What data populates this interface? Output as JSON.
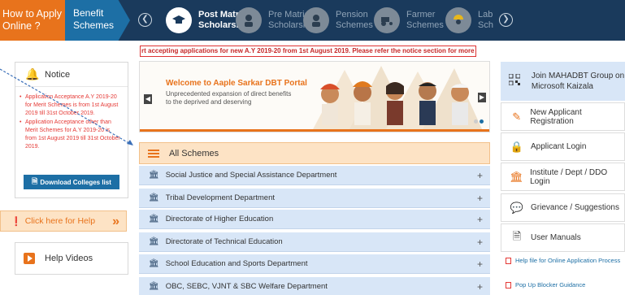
{
  "topbar": {
    "howto_label": "How to Apply Online ?",
    "benefit_label": "Benefit Schemes",
    "schemes": [
      {
        "label": "Post Matric Scholarship",
        "active": true,
        "icon": "graduation-cap-icon"
      },
      {
        "label": "Pre Matric Scholarship",
        "active": false,
        "icon": "student-icon"
      },
      {
        "label": "Pension Schemes",
        "active": false,
        "icon": "elderly-person-icon"
      },
      {
        "label": "Farmer Schemes",
        "active": false,
        "icon": "tractor-icon"
      },
      {
        "label": "Lab Sch",
        "active": false,
        "icon": "worker-icon"
      }
    ]
  },
  "ticker": {
    "text": "rt accepting applications for new A.Y 2019-20 from 1st August 2019. Please refer the notice section for more information."
  },
  "notice": {
    "title": "Notice",
    "items": [
      "Application Acceptance A.Y 2019-20 for Merit Schemes is from 1st August 2019 till 31st October 2019.",
      "Application Acceptance other than Merit Schemes for A.Y 2019-20 is from 1st August 2019 till 31st October 2019."
    ],
    "download_label": "Download Colleges list"
  },
  "help": {
    "label": "Click here for Help"
  },
  "videos": {
    "label": "Help Videos"
  },
  "slide": {
    "welcome": "Welcome to Aaple Sarkar DBT Portal",
    "tagline": "Unprecedented expansion of direct benefits to the deprived and deserving"
  },
  "schemes_list": {
    "header": "All Schemes",
    "departments": [
      "Social Justice and Special Assistance Department",
      "Tribal Development Department",
      "Directorate of Higher Education",
      "Directorate of Technical Education",
      "School Education and Sports Department",
      "OBC, SEBC, VJNT & SBC Welfare Department"
    ]
  },
  "right": {
    "group_label": "Join MAHADBT Group on Microsoft Kaizala",
    "items": [
      {
        "label": "New Applicant Registration",
        "icon": "edit-icon"
      },
      {
        "label": "Applicant Login",
        "icon": "lock-icon"
      },
      {
        "label": "Institute / Dept / DDO Login",
        "icon": "bank-icon"
      },
      {
        "label": "Grievance / Suggestions",
        "icon": "chat-icon"
      },
      {
        "label": "User Manuals",
        "icon": "document-icon"
      }
    ],
    "links": [
      "Help file for Online Application Process",
      "Pop Up Blocker Guidance"
    ]
  },
  "colors": {
    "navy": "#1a3a5c",
    "orange": "#e8731c",
    "blue": "#1d6fa5",
    "light_blue": "#d8e6f7",
    "peach": "#fde3c5",
    "red": "#e53935"
  }
}
